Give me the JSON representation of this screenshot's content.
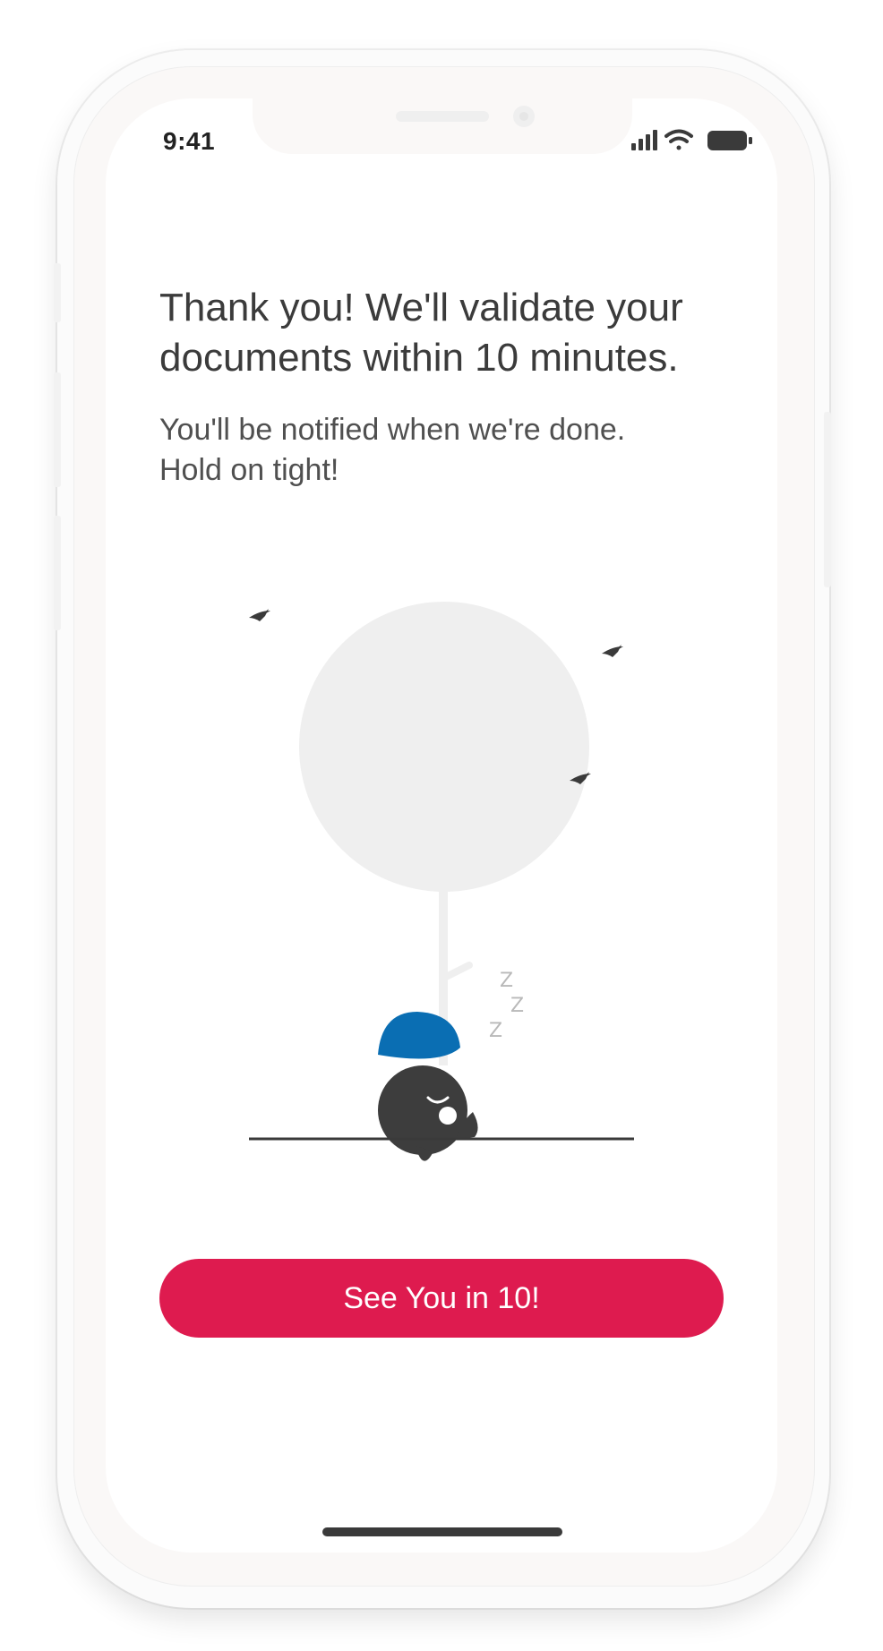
{
  "status_bar": {
    "time": "9:41",
    "icons": [
      "signal-icon",
      "wifi-icon",
      "battery-icon"
    ]
  },
  "main": {
    "headline": "Thank you! We'll validate your documents within 10 minutes.",
    "subtext_line1": "You'll be notified when we're done.",
    "subtext_line2": "Hold on tight!"
  },
  "illustration": {
    "sleep_text": [
      "Z",
      "Z",
      "Z"
    ],
    "colors": {
      "tree": "#efefef",
      "birds": "#3a3a3a",
      "character": "#3d3d3d",
      "hat": "#0a6eb3",
      "ground": "#3a3a3a"
    }
  },
  "cta": {
    "label": "See You in 10!",
    "color": "#de1b4f"
  }
}
